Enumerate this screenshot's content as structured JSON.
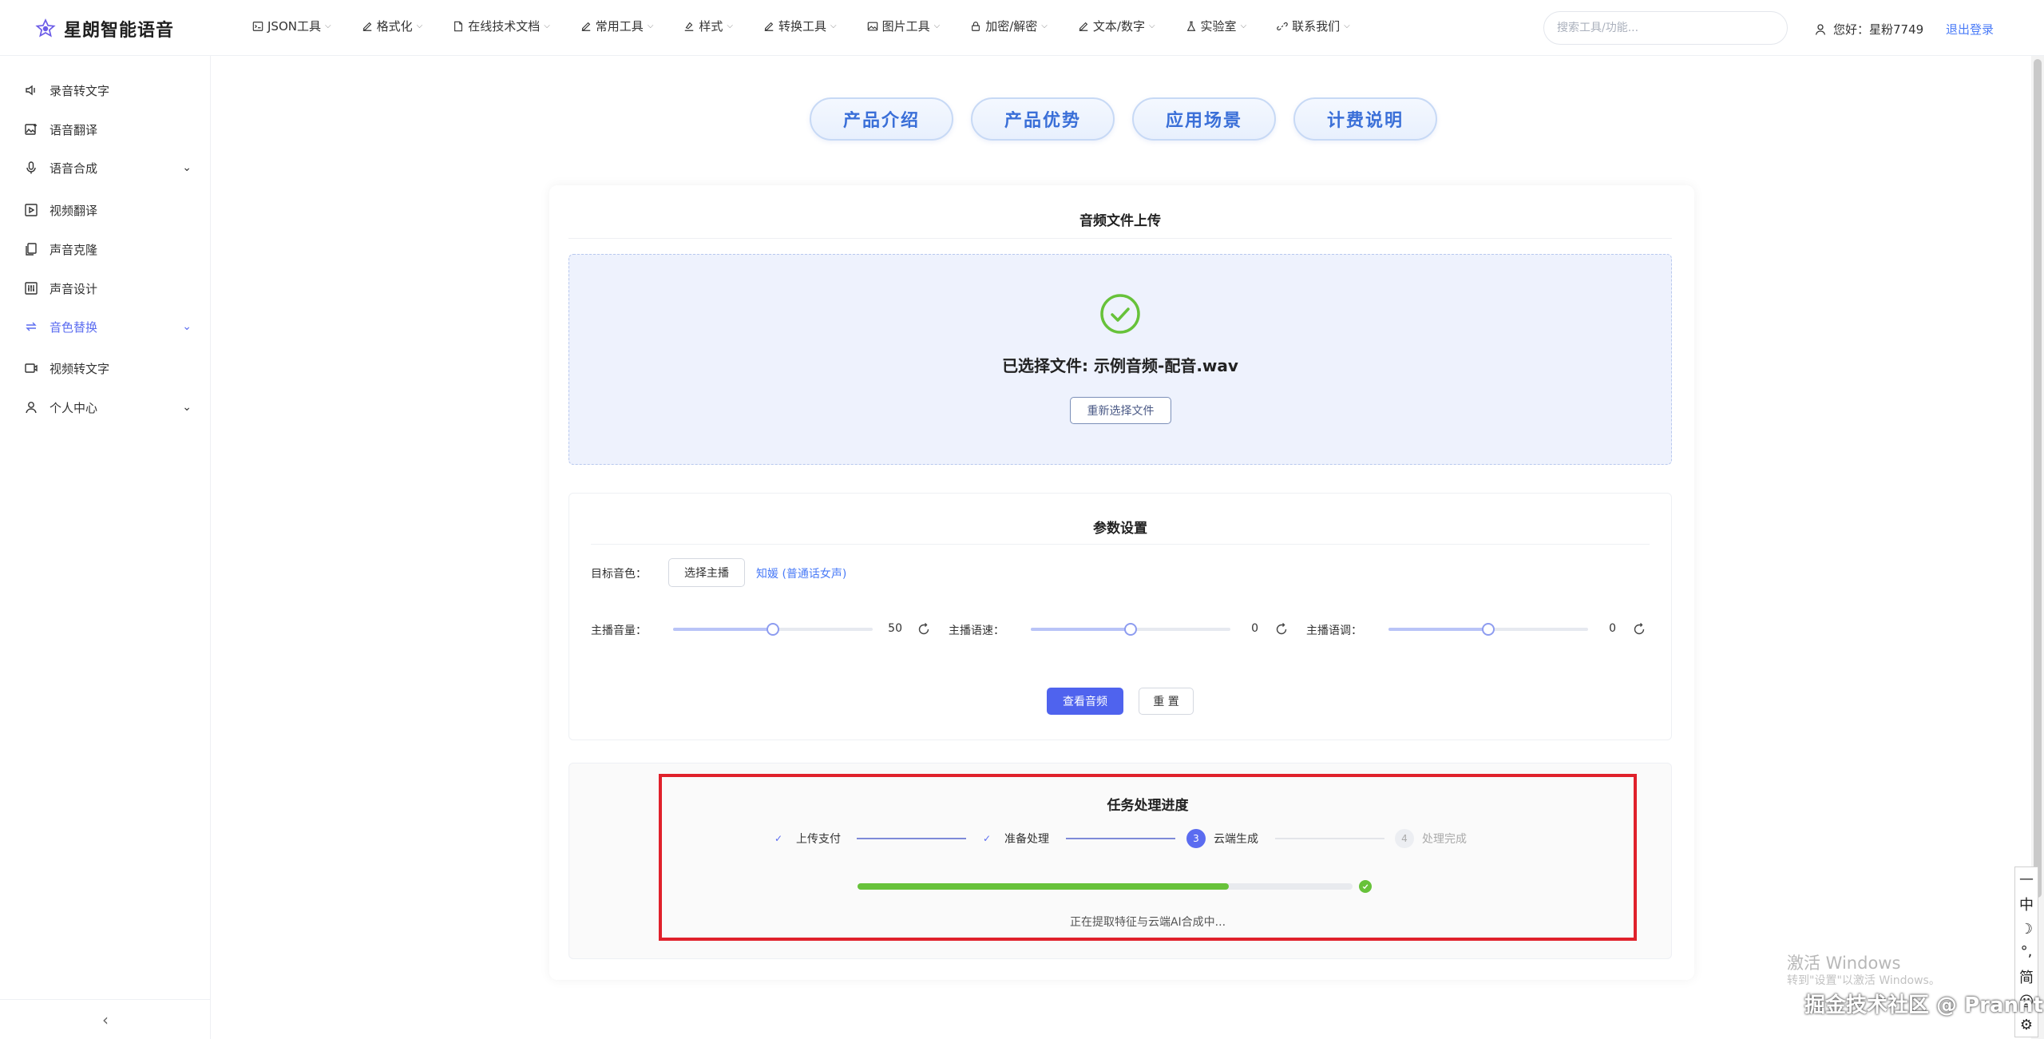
{
  "brand": {
    "name": "星朗智能语音"
  },
  "nav": [
    {
      "label": "JSON工具",
      "icon": "terminal-icon"
    },
    {
      "label": "格式化",
      "icon": "edit-icon"
    },
    {
      "label": "在线技术文档",
      "icon": "document-icon"
    },
    {
      "label": "常用工具",
      "icon": "edit-icon"
    },
    {
      "label": "样式",
      "icon": "paint-icon"
    },
    {
      "label": "转换工具",
      "icon": "edit-icon"
    },
    {
      "label": "图片工具",
      "icon": "image-icon"
    },
    {
      "label": "加密/解密",
      "icon": "lock-icon"
    },
    {
      "label": "文本/数字",
      "icon": "edit-icon"
    },
    {
      "label": "实验室",
      "icon": "flask-icon"
    },
    {
      "label": "联系我们",
      "icon": "link-icon"
    }
  ],
  "search": {
    "placeholder": "搜索工具/功能..."
  },
  "user": {
    "greeting": "您好：星粉7749",
    "logout": "退出登录"
  },
  "sidebar": {
    "items": [
      {
        "label": "录音转文字",
        "icon": "speaker-icon"
      },
      {
        "label": "语音翻译",
        "icon": "image-translate-icon"
      },
      {
        "label": "语音合成",
        "icon": "microphone-icon"
      },
      {
        "label": "视频翻译",
        "icon": "play-box-icon"
      },
      {
        "label": "声音克隆",
        "icon": "copy-icon"
      },
      {
        "label": "声音设计",
        "icon": "sliders-icon"
      },
      {
        "label": "音色替换",
        "icon": "swap-icon"
      },
      {
        "label": "视频转文字",
        "icon": "video-icon"
      },
      {
        "label": "个人中心",
        "icon": "user-icon"
      }
    ],
    "collapse_icon": "chevron-left-icon"
  },
  "tabs": [
    "产品介绍",
    "产品优势",
    "应用场景",
    "计费说明"
  ],
  "upload": {
    "title": "音频文件上传",
    "selected_label": "已选择文件: 示例音频-配音.wav",
    "reselect": "重新选择文件"
  },
  "params": {
    "title": "参数设置",
    "target_voice_label": "目标音色：",
    "choose_host": "选择主播",
    "voice_name": "知媛 (普通话女声)",
    "sliders": [
      {
        "label": "主播音量：",
        "value": "50",
        "fraction": 0.5
      },
      {
        "label": "主播语速：",
        "value": "0",
        "fraction": 0.5
      },
      {
        "label": "主播语调：",
        "value": "0",
        "fraction": 0.5
      }
    ],
    "view_audio": "查看音频",
    "reset": "重 置"
  },
  "progress": {
    "title": "任务处理进度",
    "steps": [
      {
        "label": "上传支付",
        "state": "done",
        "number": ""
      },
      {
        "label": "准备处理",
        "state": "done",
        "number": ""
      },
      {
        "label": "云端生成",
        "state": "active",
        "number": "3"
      },
      {
        "label": "处理完成",
        "state": "pending",
        "number": "4"
      }
    ],
    "percent": 75,
    "status": "正在提取特征与云端AI合成中..."
  },
  "ime": {
    "items": [
      "—",
      "中",
      "☽",
      "°,",
      "简",
      "☺",
      "⚙"
    ]
  },
  "watermarks": {
    "windows_title": "激活 Windows",
    "windows_sub": "转到\"设置\"以激活 Windows。",
    "community": "掘金技术社区 @ Prannt"
  },
  "colors": {
    "accent": "#5b6cf0",
    "success": "#67c23a",
    "highlight": "#e0212b",
    "link": "#4a7bf7"
  }
}
